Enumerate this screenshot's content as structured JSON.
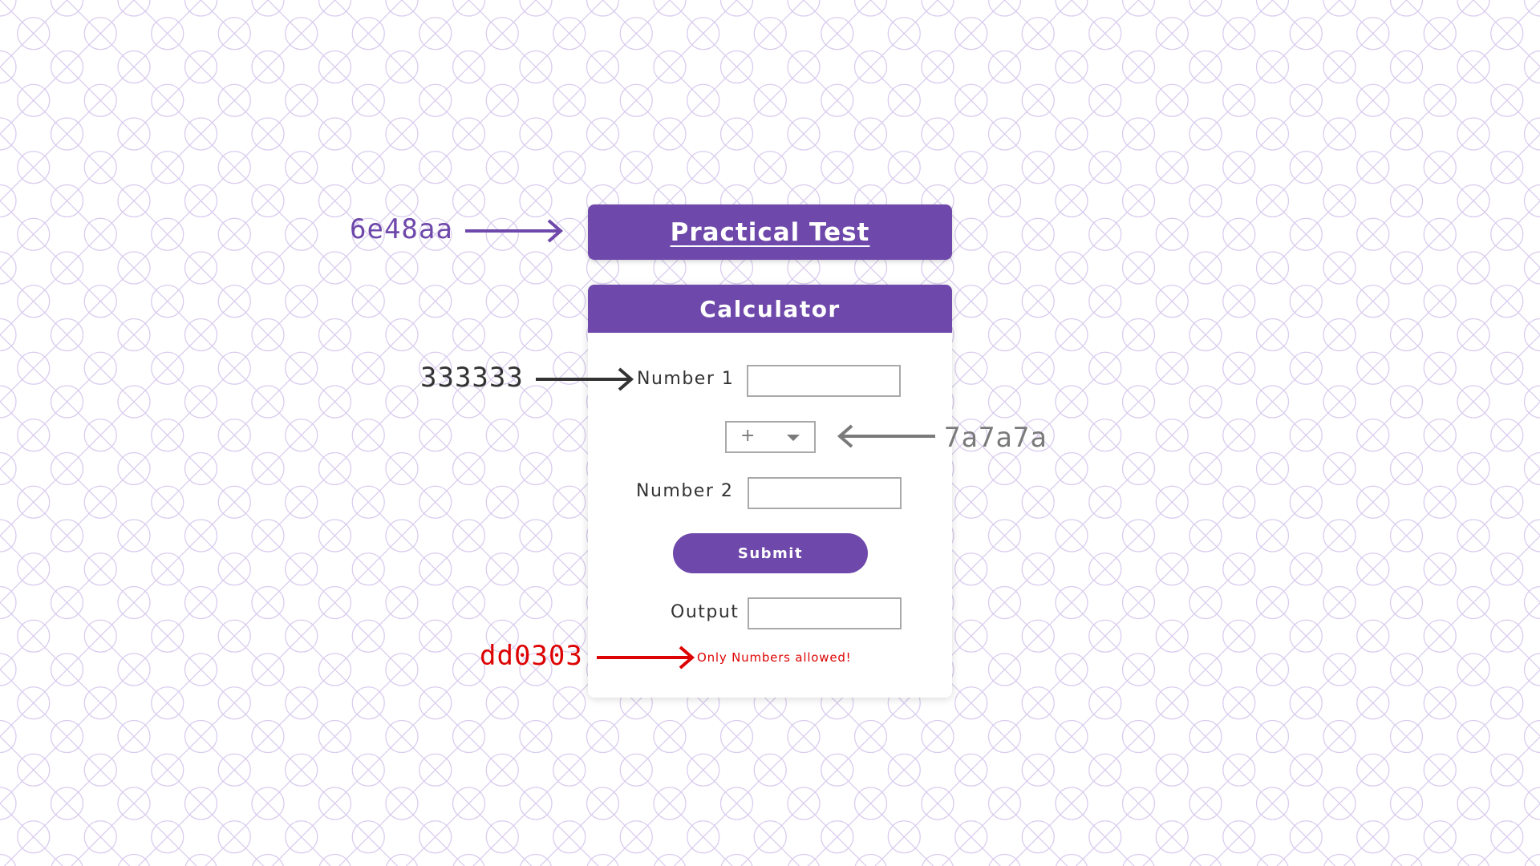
{
  "header": {
    "title": "Practical Test"
  },
  "calculator": {
    "title": "Calculator",
    "number1": {
      "label": "Number 1",
      "value": ""
    },
    "operator": {
      "selected": "+"
    },
    "number2": {
      "label": "Number 2",
      "value": ""
    },
    "submit_label": "Submit",
    "output": {
      "label": "Output",
      "value": ""
    },
    "error_message": "Only Numbers allowed!"
  },
  "annotations": [
    {
      "text": "6e48aa",
      "color": "#6e48aa",
      "points_to": "header"
    },
    {
      "text": "333333",
      "color": "#333333",
      "points_to": "field-label"
    },
    {
      "text": "7a7a7a",
      "color": "#7a7a7a",
      "points_to": "operator-select"
    },
    {
      "text": "dd0303",
      "color": "#dd0303",
      "points_to": "error-message"
    }
  ],
  "colors": {
    "primary": "#6e48aa",
    "text": "#333333",
    "muted": "#7a7a7a",
    "error": "#dd0303",
    "pattern": "#d9ccee"
  },
  "icons": {
    "background_pattern": "circle-x-diamond-lattice",
    "select_caret": "caret-down-icon",
    "annotation_arrow": "arrow-right-icon"
  }
}
